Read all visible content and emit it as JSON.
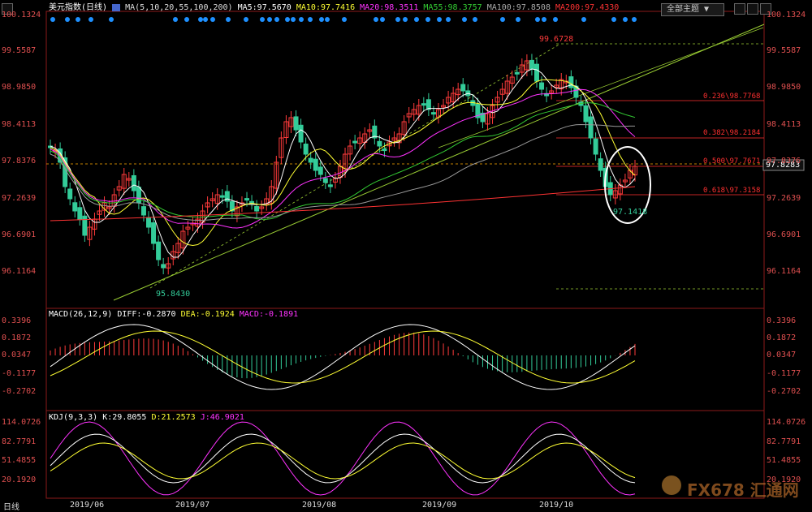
{
  "header": {
    "title": "美元指数(日线)",
    "ma_params": "MA(5,10,20,55,100,200)",
    "ma5": "MA5:97.5670",
    "ma10": "MA10:97.7416",
    "ma20": "MA20:98.3511",
    "ma55": "MA55:98.3757",
    "ma100": "MA100:97.8508",
    "ma200": "MA200:97.4330",
    "theme_button": "全部主题"
  },
  "price_axis": [
    "100.1324",
    "99.5587",
    "98.9850",
    "98.4113",
    "97.8376",
    "97.2639",
    "96.6901",
    "96.1164"
  ],
  "right_axis": [
    "100.1324",
    "99.5587",
    "98.9850",
    "98.4113",
    "97.8376",
    "97.2639",
    "96.6901",
    "96.1164"
  ],
  "current_price": "97.8283",
  "annotations": {
    "high": "99.6728",
    "low": "95.8430",
    "recent_low": "97.1418"
  },
  "fib_levels": [
    {
      "label": "0.236\\98.7768"
    },
    {
      "label": "0.382\\98.2184"
    },
    {
      "label": "0.500\\97.7671"
    },
    {
      "label": "0.618\\97.3158"
    }
  ],
  "macd": {
    "title": "MACD(26,12,9)",
    "diff": "DIFF:-0.2870",
    "dea": "DEA:-0.1924",
    "macd": "MACD:-0.1891",
    "axis": [
      "0.3396",
      "0.1872",
      "0.0347",
      "-0.1177",
      "-0.2702"
    ]
  },
  "kdj": {
    "title": "KDJ(9,3,3)",
    "k": "K:29.8055",
    "d": "D:21.2573",
    "j": "J:46.9021",
    "axis": [
      "114.0726",
      "82.7791",
      "51.4855",
      "20.1920"
    ]
  },
  "dates": [
    "2019/06",
    "2019/07",
    "2019/08",
    "2019/09",
    "2019/10"
  ],
  "footer_tab": "日线",
  "watermark": "FX678 汇通网",
  "colors": {
    "up": "#ff3b3b",
    "down": "#33cc99",
    "ma5": "#ffffff",
    "ma10": "#ffff33",
    "ma20": "#ff33ff",
    "ma55": "#33cc33",
    "ma100": "#999999",
    "ma200": "#ff3333"
  }
}
